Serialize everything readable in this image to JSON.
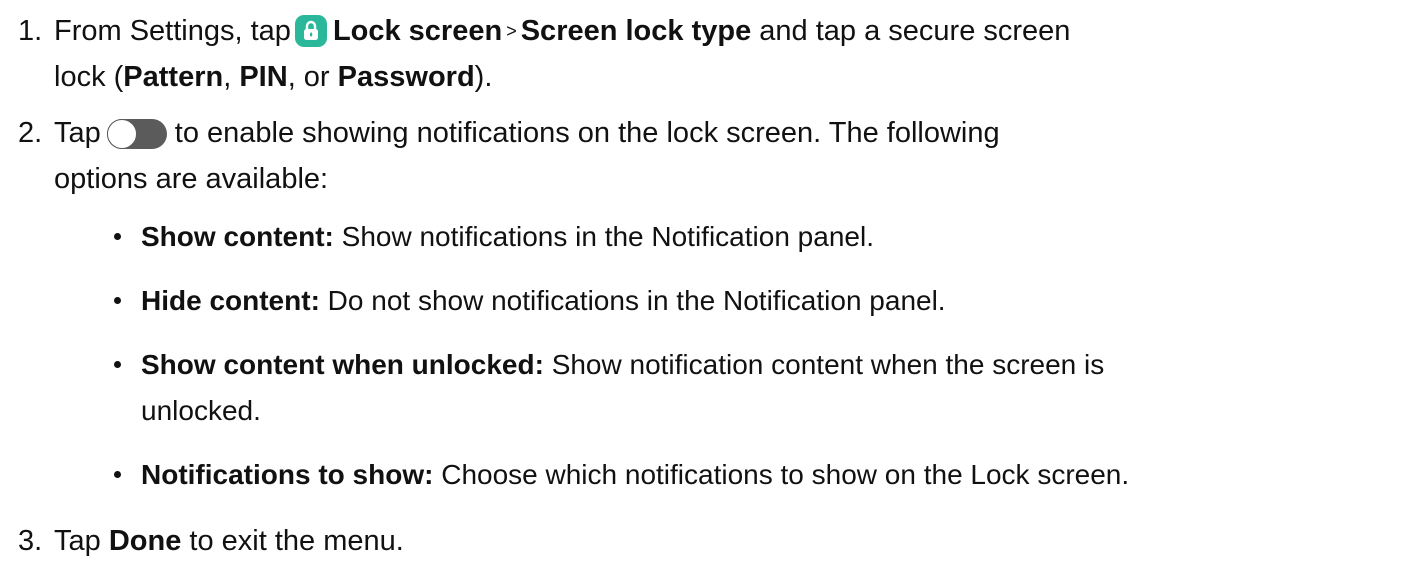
{
  "steps": [
    {
      "number": "1.",
      "pre": "From Settings, tap",
      "icon": "lock-icon",
      "menu1": "Lock screen",
      "separator": ">",
      "menu2": "Screen lock type",
      "post": "and tap a secure screen",
      "line2_pre": "lock (",
      "opt1": "Pattern",
      "comma1": ",",
      "opt2": "PIN",
      "mid": ", or",
      "opt3": "Password",
      "end": ")."
    },
    {
      "number": "2.",
      "pre": "Tap",
      "icon": "toggle-icon",
      "post": "to enable showing notifications on the lock screen. The following",
      "line2": "options are available:"
    },
    {
      "number": "3.",
      "pre": "Tap",
      "bold": "Done",
      "post": "to exit the menu."
    }
  ],
  "options": [
    {
      "term": "Show content",
      "colon": ":",
      "desc": "Show notifications in the Notification panel."
    },
    {
      "term": "Hide content",
      "colon": ":",
      "desc": "Do not show notifications in the Notification panel."
    },
    {
      "term": "Show content when unlocked",
      "colon": ":",
      "desc": "Show notification content when the screen is",
      "desc2": "unlocked."
    },
    {
      "term": "Notifications to show",
      "colon": ":",
      "desc": "Choose which notifications to show on the Lock screen."
    }
  ],
  "colors": {
    "lock_icon_bg": "#2bb89a",
    "toggle_bg": "#5b5b5b",
    "text": "#111111"
  }
}
